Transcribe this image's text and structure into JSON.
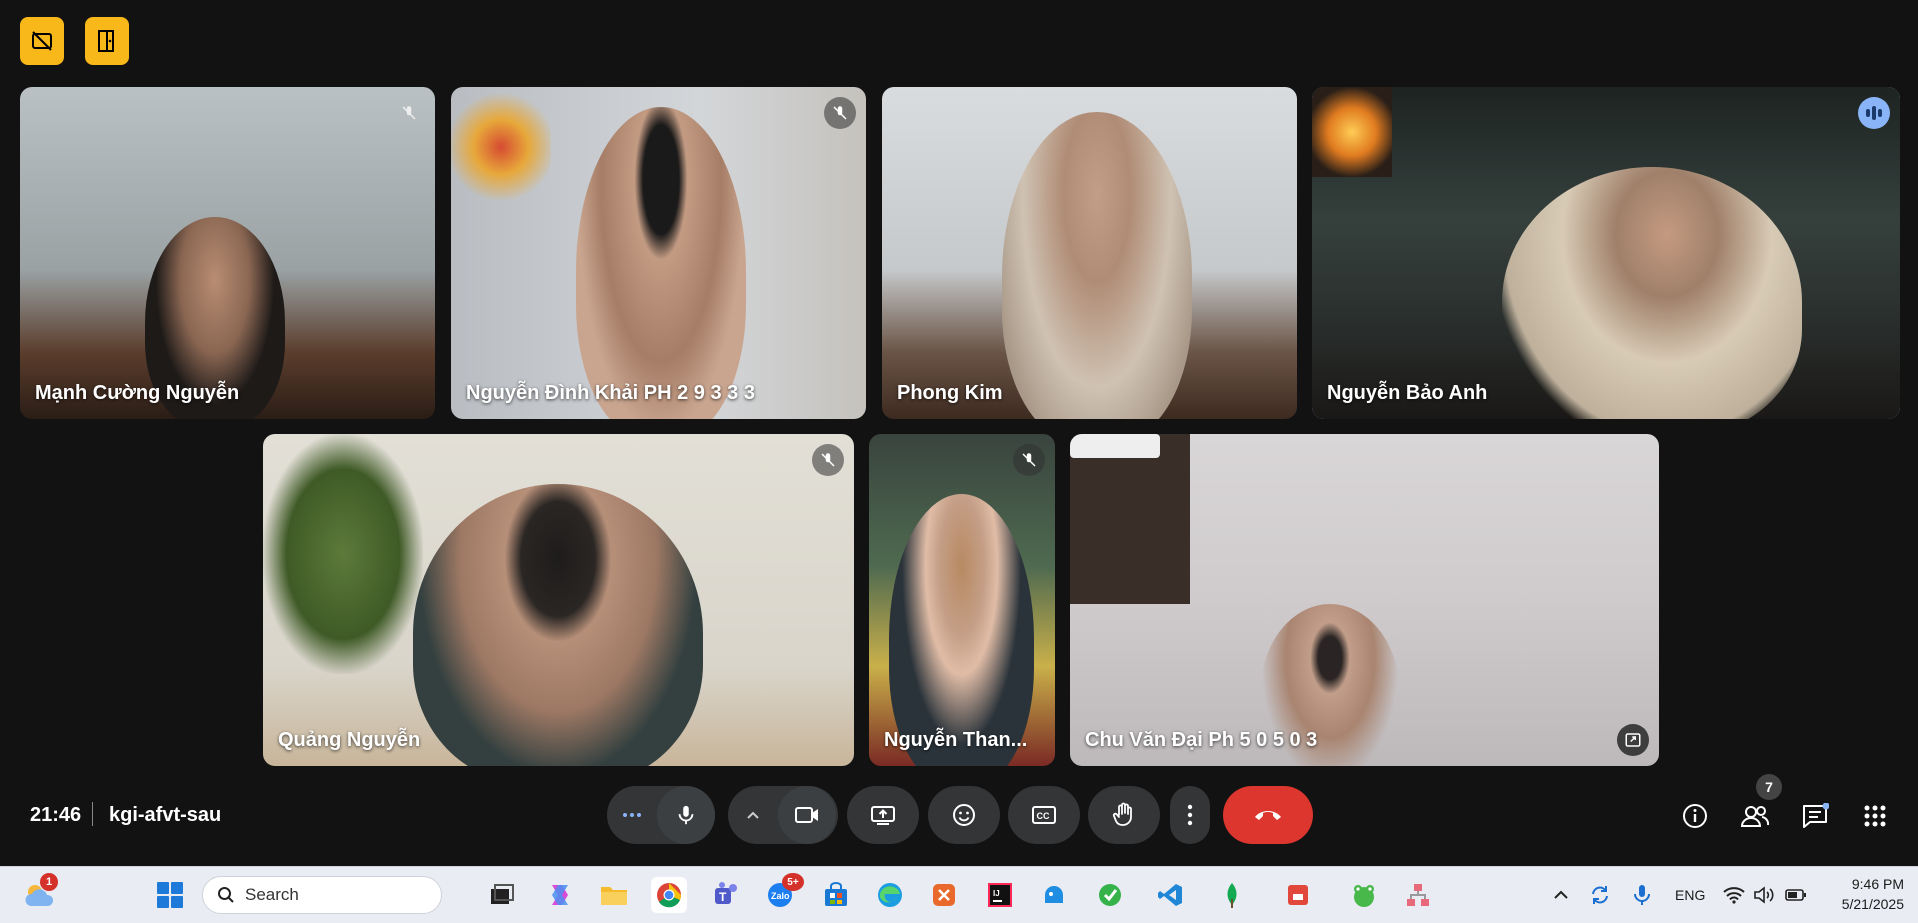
{
  "top_buttons": [
    {
      "icon": "camera-off-icon"
    },
    {
      "icon": "door-exit-icon"
    }
  ],
  "participants": [
    {
      "name": "Mạnh Cường Nguyễn",
      "status": "muted"
    },
    {
      "name": "Nguyễn Đình Khải PH 2 9 3 3 3",
      "status": "muted"
    },
    {
      "name": "Phong Kim",
      "status": ""
    },
    {
      "name": "Nguyễn Bảo Anh",
      "status": "speaking"
    },
    {
      "name": "Quảng Nguyễn",
      "status": "muted"
    },
    {
      "name": "Nguyễn Than...",
      "status": "muted"
    },
    {
      "name": "Chu Văn Đại Ph 5 0 5 0 3",
      "status": "pinned-view"
    }
  ],
  "meeting": {
    "time": "21:46",
    "code": "kgi-afvt-sau",
    "participant_count": "7"
  },
  "controls": {
    "more_audio": "more-options-icon",
    "mic": "microphone-icon",
    "camera_options": "chevron-up-icon",
    "camera": "video-camera-icon",
    "present": "present-screen-icon",
    "reactions": "emoji-icon",
    "captions": "captions-icon",
    "raise_hand": "hand-icon",
    "more": "more-vert-icon",
    "end_call": "end-call-icon"
  },
  "taskbar": {
    "weather_badge": "1",
    "search_placeholder": "Search",
    "zalo_badge": "5+",
    "language": "ENG",
    "time": "9:46 PM",
    "date": "5/21/2025"
  },
  "colors": {
    "background": "#121212",
    "accent_yellow": "#f9b819",
    "end_call_red": "#dc362e",
    "speaking_blue": "#8ab4f8"
  }
}
